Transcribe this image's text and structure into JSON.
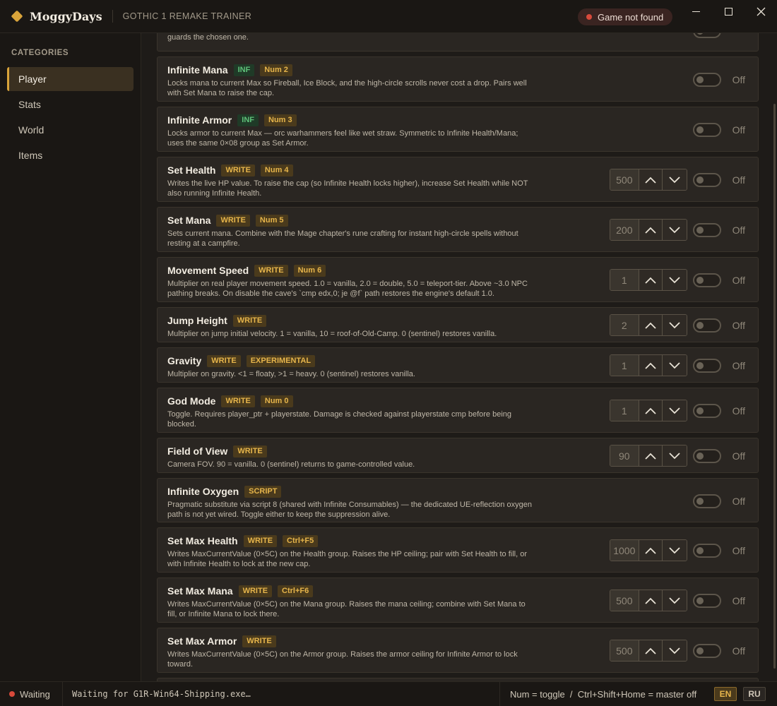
{
  "app": {
    "brand": "MoggyDays",
    "title": "GOTHIC 1 REMAKE TRAINER",
    "status": "Game not found"
  },
  "sidebar": {
    "heading": "CATEGORIES",
    "items": [
      {
        "label": "Player",
        "active": true
      },
      {
        "label": "Stats",
        "active": false
      },
      {
        "label": "World",
        "active": false
      },
      {
        "label": "Items",
        "active": false
      }
    ]
  },
  "cheats": [
    {
      "title": "",
      "tags": [],
      "desc": "Locks HP to current Max every tick. Damage still registers visually for one frame, then snaps back — Innos guards the chosen one.",
      "value": "",
      "toggle": "Off"
    },
    {
      "title": "Infinite Mana",
      "tags": [
        {
          "text": "INF",
          "kind": "inf"
        },
        {
          "text": "Num 2",
          "kind": "key"
        }
      ],
      "desc": "Locks mana to current Max so Fireball, Ice Block, and the high-circle scrolls never cost a drop. Pairs well with Set Mana to raise the cap.",
      "value": "",
      "toggle": "Off"
    },
    {
      "title": "Infinite Armor",
      "tags": [
        {
          "text": "INF",
          "kind": "inf"
        },
        {
          "text": "Num 3",
          "kind": "key"
        }
      ],
      "desc": "Locks armor to current Max — orc warhammers feel like wet straw. Symmetric to Infinite Health/Mana; uses the same 0×08 group as Set Armor.",
      "value": "",
      "toggle": "Off"
    },
    {
      "title": "Set Health",
      "tags": [
        {
          "text": "WRITE",
          "kind": "write"
        },
        {
          "text": "Num 4",
          "kind": "key"
        }
      ],
      "desc": "Writes the live HP value. To raise the cap (so Infinite Health locks higher), increase Set Health while NOT also running Infinite Health.",
      "value": "500",
      "toggle": "Off"
    },
    {
      "title": "Set Mana",
      "tags": [
        {
          "text": "WRITE",
          "kind": "write"
        },
        {
          "text": "Num 5",
          "kind": "key"
        }
      ],
      "desc": "Sets current mana. Combine with the Mage chapter's rune crafting for instant high-circle spells without resting at a campfire.",
      "value": "200",
      "toggle": "Off"
    },
    {
      "title": "Movement Speed",
      "tags": [
        {
          "text": "WRITE",
          "kind": "write"
        },
        {
          "text": "Num 6",
          "kind": "key"
        }
      ],
      "desc": "Multiplier on real player movement speed. 1.0 = vanilla, 2.0 = double, 5.0 = teleport-tier. Above ~3.0 NPC pathing breaks. On disable the cave's `cmp edx,0; je @f` path restores the engine's default 1.0.",
      "value": "1",
      "toggle": "Off"
    },
    {
      "title": "Jump Height",
      "tags": [
        {
          "text": "WRITE",
          "kind": "write"
        }
      ],
      "desc": "Multiplier on jump initial velocity. 1 = vanilla, 10 = roof-of-Old-Camp. 0 (sentinel) restores vanilla.",
      "value": "2",
      "toggle": "Off"
    },
    {
      "title": "Gravity",
      "tags": [
        {
          "text": "WRITE",
          "kind": "write"
        },
        {
          "text": "EXPERIMENTAL",
          "kind": "write"
        }
      ],
      "desc": "Multiplier on gravity. <1 = floaty, >1 = heavy. 0 (sentinel) restores vanilla.",
      "value": "1",
      "toggle": "Off"
    },
    {
      "title": "God Mode",
      "tags": [
        {
          "text": "WRITE",
          "kind": "write"
        },
        {
          "text": "Num 0",
          "kind": "key"
        }
      ],
      "desc": "Toggle. Requires player_ptr + playerstate. Damage is checked against playerstate cmp before being blocked.",
      "value": "1",
      "toggle": "Off"
    },
    {
      "title": "Field of View",
      "tags": [
        {
          "text": "WRITE",
          "kind": "write"
        }
      ],
      "desc": "Camera FOV. 90 = vanilla. 0 (sentinel) returns to game-controlled value.",
      "value": "90",
      "toggle": "Off"
    },
    {
      "title": "Infinite Oxygen",
      "tags": [
        {
          "text": "SCRIPT",
          "kind": "write"
        }
      ],
      "desc": "Pragmatic substitute via script 8 (shared with Infinite Consumables) — the dedicated UE-reflection oxygen path is not yet wired. Toggle either to keep the suppression alive.",
      "value": "",
      "toggle": "Off"
    },
    {
      "title": "Set Max Health",
      "tags": [
        {
          "text": "WRITE",
          "kind": "write"
        },
        {
          "text": "Ctrl+F5",
          "kind": "key"
        }
      ],
      "desc": "Writes MaxCurrentValue (0×5C) on the Health group. Raises the HP ceiling; pair with Set Health to fill, or with Infinite Health to lock at the new cap.",
      "value": "1000",
      "toggle": "Off"
    },
    {
      "title": "Set Max Mana",
      "tags": [
        {
          "text": "WRITE",
          "kind": "write"
        },
        {
          "text": "Ctrl+F6",
          "kind": "key"
        }
      ],
      "desc": "Writes MaxCurrentValue (0×5C) on the Mana group. Raises the mana ceiling; combine with Set Mana to fill, or Infinite Mana to lock there.",
      "value": "500",
      "toggle": "Off"
    },
    {
      "title": "Set Max Armor",
      "tags": [
        {
          "text": "WRITE",
          "kind": "write"
        }
      ],
      "desc": "Writes MaxCurrentValue (0×5C) on the Armor group. Raises the armor ceiling for Infinite Armor to lock toward.",
      "value": "500",
      "toggle": "Off"
    }
  ],
  "statusbar": {
    "state": "Waiting",
    "log": "Waiting for G1R-Win64-Shipping.exe…",
    "hint": "Num = toggle  /  Ctrl+Shift+Home = master off",
    "lang_en": "EN",
    "lang_ru": "RU"
  },
  "colors": {
    "accent": "#d9a43a",
    "background": "#1e1b18",
    "card": "#2a2622",
    "status_error": "#d84a3b",
    "tag_inf": "#5fc27a"
  }
}
